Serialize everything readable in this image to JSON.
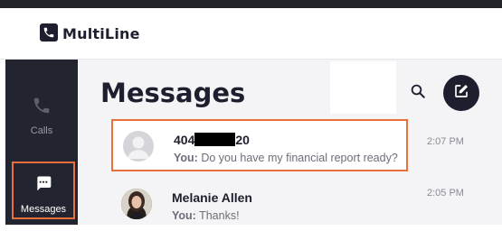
{
  "app": {
    "name": "MultiLine"
  },
  "sidebar": {
    "items": [
      {
        "label": "Calls",
        "icon": "phone-icon",
        "active": false
      },
      {
        "label": "Messages",
        "icon": "chat-bubble-icon",
        "active": true
      }
    ]
  },
  "main": {
    "title": "Messages",
    "search_icon": "search-icon",
    "compose_icon": "compose-icon"
  },
  "conversations": [
    {
      "name_prefix": "404",
      "name_suffix": "20",
      "redacted": true,
      "preview_prefix": "You:",
      "preview_text": " Do you have my financial report ready?",
      "time": "2:07 PM",
      "selected": true
    },
    {
      "name": "Melanie Allen",
      "preview_prefix": "You:",
      "preview_text": " Thanks!",
      "time": "2:05 PM",
      "selected": false
    }
  ],
  "colors": {
    "sidebar_bg": "#22242f",
    "accent_outline": "#e8703a",
    "brand_dark": "#1e1f2e",
    "main_bg": "#f4f4f6"
  }
}
